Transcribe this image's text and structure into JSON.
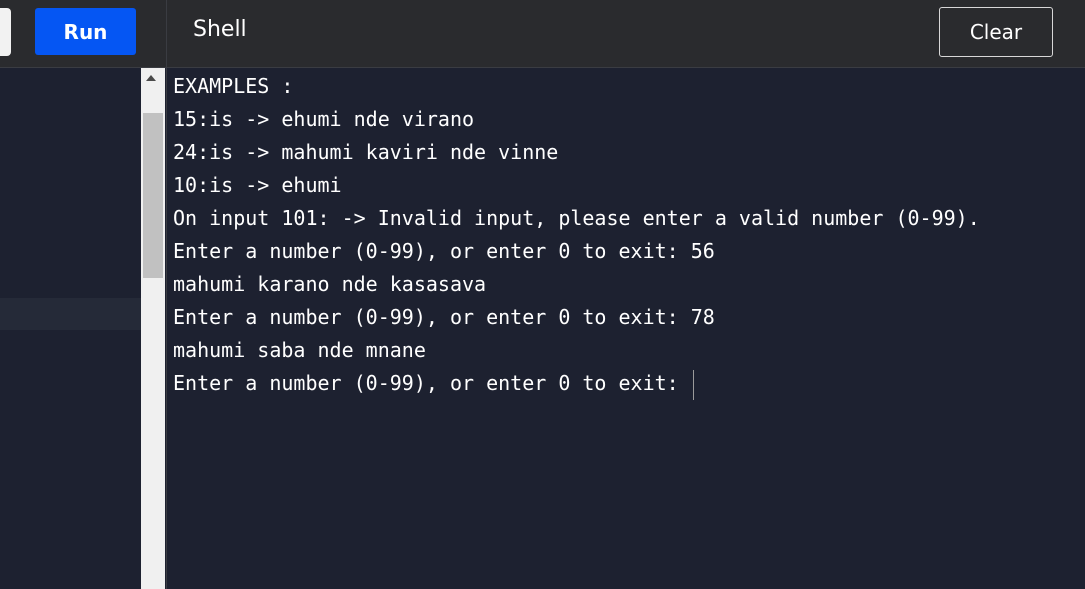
{
  "toolbar": {
    "run_label": "Run",
    "shell_title": "Shell",
    "clear_label": "Clear"
  },
  "colors": {
    "run_button": "#0556f3",
    "toolbar_bg": "#2a2b2e",
    "shell_bg": "#1d2130",
    "text": "#ffffff"
  },
  "shell": {
    "lines": [
      "EXAMPLES :",
      "15:is -> ehumi nde virano",
      "24:is -> mahumi kaviri nde vinne",
      "10:is -> ehumi",
      "On input 101: -> Invalid input, please enter a valid number (0-99).",
      "Enter a number (0-99), or enter 0 to exit: 56",
      "mahumi karano nde kasasava",
      "Enter a number (0-99), or enter 0 to exit: 78",
      "mahumi saba nde mnane",
      "Enter a number (0-99), or enter 0 to exit: "
    ]
  }
}
